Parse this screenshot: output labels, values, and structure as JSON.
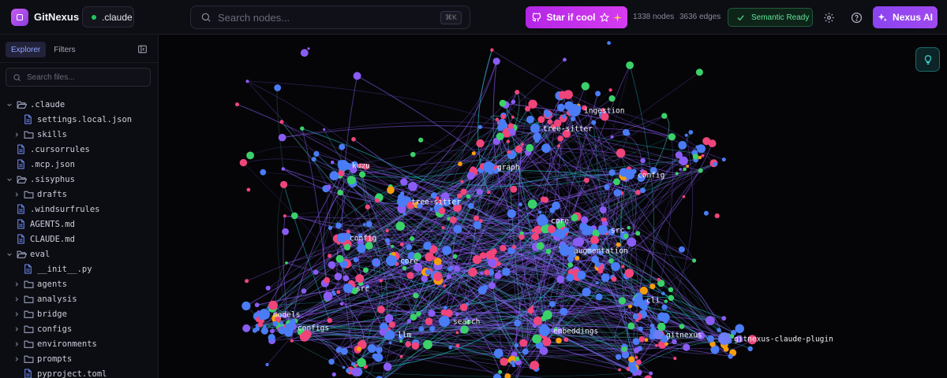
{
  "header": {
    "brand": "GitNexus",
    "repo": ".claude",
    "search_placeholder": "Search nodes...",
    "search_shortcut": "⌘K",
    "star_label": "Star if cool",
    "node_count": "1338 nodes",
    "edge_count": "3636 edges",
    "semantic_status": "Semantic Ready",
    "nexus_ai_label": "Nexus AI"
  },
  "sidebar": {
    "tabs": [
      {
        "label": "Explorer",
        "active": true
      },
      {
        "label": "Filters",
        "active": false
      }
    ],
    "search_placeholder": "Search files...",
    "tree": [
      {
        "name": ".claude",
        "type": "folder",
        "expanded": true,
        "depth": 0
      },
      {
        "name": "settings.local.json",
        "type": "file",
        "depth": 1
      },
      {
        "name": "skills",
        "type": "folder",
        "expanded": false,
        "depth": 1
      },
      {
        "name": ".cursorrules",
        "type": "file",
        "depth": 0
      },
      {
        "name": ".mcp.json",
        "type": "file",
        "depth": 0
      },
      {
        "name": ".sisyphus",
        "type": "folder",
        "expanded": true,
        "depth": 0
      },
      {
        "name": "drafts",
        "type": "folder",
        "expanded": false,
        "depth": 1
      },
      {
        "name": ".windsurfrules",
        "type": "file",
        "depth": 0
      },
      {
        "name": "AGENTS.md",
        "type": "file",
        "depth": 0
      },
      {
        "name": "CLAUDE.md",
        "type": "file",
        "depth": 0
      },
      {
        "name": "eval",
        "type": "folder",
        "expanded": true,
        "depth": 0
      },
      {
        "name": "__init__.py",
        "type": "file",
        "depth": 1
      },
      {
        "name": "agents",
        "type": "folder",
        "expanded": false,
        "depth": 1
      },
      {
        "name": "analysis",
        "type": "folder",
        "expanded": false,
        "depth": 1
      },
      {
        "name": "bridge",
        "type": "folder",
        "expanded": false,
        "depth": 1
      },
      {
        "name": "configs",
        "type": "folder",
        "expanded": false,
        "depth": 1
      },
      {
        "name": "environments",
        "type": "folder",
        "expanded": false,
        "depth": 1
      },
      {
        "name": "prompts",
        "type": "folder",
        "expanded": false,
        "depth": 1
      },
      {
        "name": "pyproject.toml",
        "type": "file",
        "depth": 1
      }
    ]
  },
  "graph": {
    "labels": [
      "ingestion",
      "tree-sitter",
      "kuzu",
      "graph",
      "config",
      "tree-sitter",
      "core",
      "src",
      "config",
      "augmentation",
      "core",
      "src",
      "cli",
      "models",
      "configs",
      "search",
      "embeddings",
      "llm",
      "gitnexus",
      "gitnexus-claude-plugin"
    ],
    "colors": {
      "blue": "#4a7cf5",
      "purple": "#8a5cf5",
      "pink": "#f0457a",
      "green": "#3bd16a",
      "orange": "#f59e0b",
      "cyan": "#25c4d4"
    }
  }
}
